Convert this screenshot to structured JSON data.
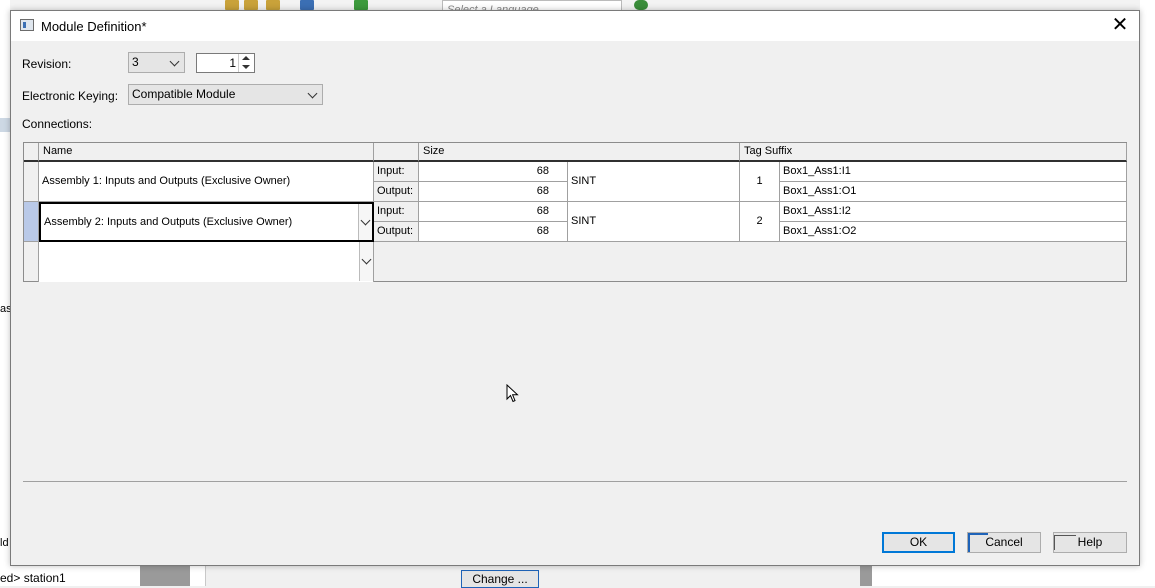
{
  "background": {
    "language_placeholder": "Select a Language",
    "station_text": "ed> station1",
    "change_button": "Change ...",
    "left_cutoff_1": "ase",
    "left_cutoff_2": "ld"
  },
  "dialog": {
    "title": "Module Definition*",
    "revision": {
      "label": "Revision:",
      "major": "3",
      "minor": "1"
    },
    "keying": {
      "label": "Electronic Keying:",
      "value": "Compatible Module"
    },
    "connections_label": "Connections:",
    "grid": {
      "headers": {
        "name": "Name",
        "size": "Size",
        "tag_suffix": "Tag Suffix"
      },
      "rows": [
        {
          "name": "Assembly 1: Inputs and Outputs (Exclusive Owner)",
          "input_label": "Input:",
          "input_size": "68",
          "output_label": "Output:",
          "output_size": "68",
          "type": "SINT",
          "index": "1",
          "input_tag": "Box1_Ass1:I1",
          "output_tag": "Box1_Ass1:O1"
        },
        {
          "name": "Assembly 2: Inputs and Outputs (Exclusive Owner)",
          "input_label": "Input:",
          "input_size": "68",
          "output_label": "Output:",
          "output_size": "68",
          "type": "SINT",
          "index": "2",
          "input_tag": "Box1_Ass1:I2",
          "output_tag": "Box1_Ass1:O2"
        }
      ]
    },
    "buttons": {
      "ok": "OK",
      "cancel": "Cancel",
      "help": "Help"
    }
  }
}
